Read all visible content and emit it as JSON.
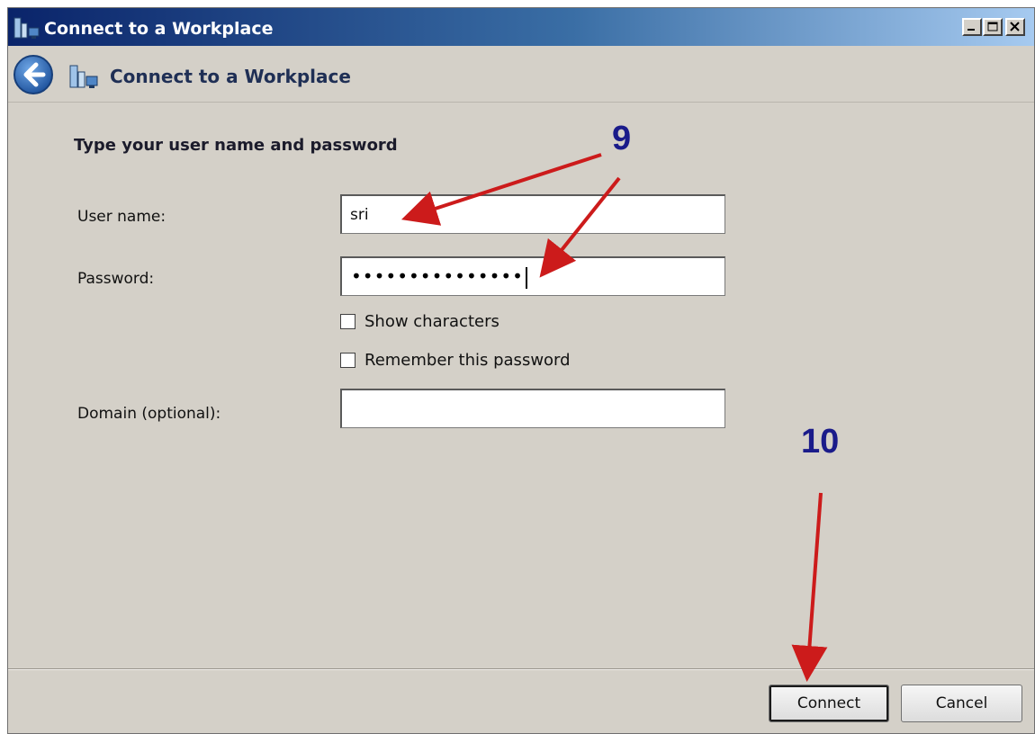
{
  "window": {
    "title": "Connect to a Workplace",
    "controls": [
      "minimize-icon",
      "maximize-icon",
      "close-icon"
    ]
  },
  "nav": {
    "title": "Connect to a Workplace",
    "back_icon": "back-arrow-icon",
    "app_icon": "workplace-network-icon"
  },
  "form": {
    "heading": "Type your user name and password",
    "username_label": "User name:",
    "username_value": "sri",
    "password_label": "Password:",
    "password_value": "•••••••••••••••",
    "show_characters_label": "Show characters",
    "show_characters_checked": false,
    "remember_label": "Remember this password",
    "remember_checked": false,
    "domain_label": "Domain (optional):",
    "domain_value": ""
  },
  "buttons": {
    "connect": "Connect",
    "cancel": "Cancel"
  },
  "annotations": {
    "step_9": "9",
    "step_10": "10",
    "arrow_color": "#cc1b1b",
    "number_color": "#1a1b8a"
  },
  "colors": {
    "window_bg": "#d4d0c8",
    "titlebar_start": "#0a246a",
    "titlebar_end": "#a6caf0"
  }
}
